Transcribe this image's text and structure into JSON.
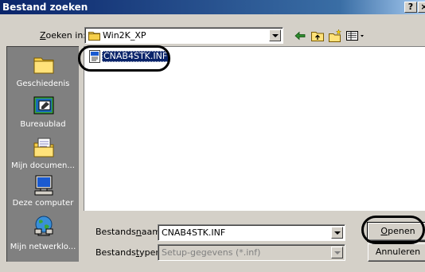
{
  "window": {
    "title": "Bestand zoeken",
    "help_label": "?",
    "close_label": "×"
  },
  "lookin": {
    "label_pre": "",
    "label_accel": "Z",
    "label_post": "oeken in:",
    "folder": "Win2K_XP"
  },
  "toolbar": {
    "icons": [
      "back-arrow-icon",
      "up-folder-icon",
      "new-folder-icon",
      "view-menu-icon"
    ]
  },
  "places": [
    {
      "label": "Geschiedenis",
      "icon": "history-folder-icon"
    },
    {
      "label": "Bureaublad",
      "icon": "desktop-icon"
    },
    {
      "label": "Mijn documen...",
      "icon": "my-documents-icon"
    },
    {
      "label": "Deze computer",
      "icon": "computer-icon"
    },
    {
      "label": "Mijn netwerklo...",
      "icon": "network-places-icon"
    }
  ],
  "files": [
    {
      "name": "CNAB4STK.INF",
      "selected": true,
      "icon": "inf-file-icon"
    }
  ],
  "filename": {
    "label_pre": "Bestands",
    "label_accel": "n",
    "label_post": "aam:",
    "value": "CNAB4STK.INF"
  },
  "filetype": {
    "label_pre": "Bestands",
    "label_accel": "t",
    "label_post": "ypen:",
    "value": "Setup-gegevens (*.inf)",
    "disabled": true
  },
  "buttons": {
    "open_accel": "O",
    "open_rest": "penen",
    "cancel": "Annuleren"
  },
  "colors": {
    "title_bar": "#0a246a",
    "dialog_face": "#d4d0c8",
    "places_bar": "#808080",
    "selection": "#0a246a",
    "highlight_ring": "#000000"
  }
}
